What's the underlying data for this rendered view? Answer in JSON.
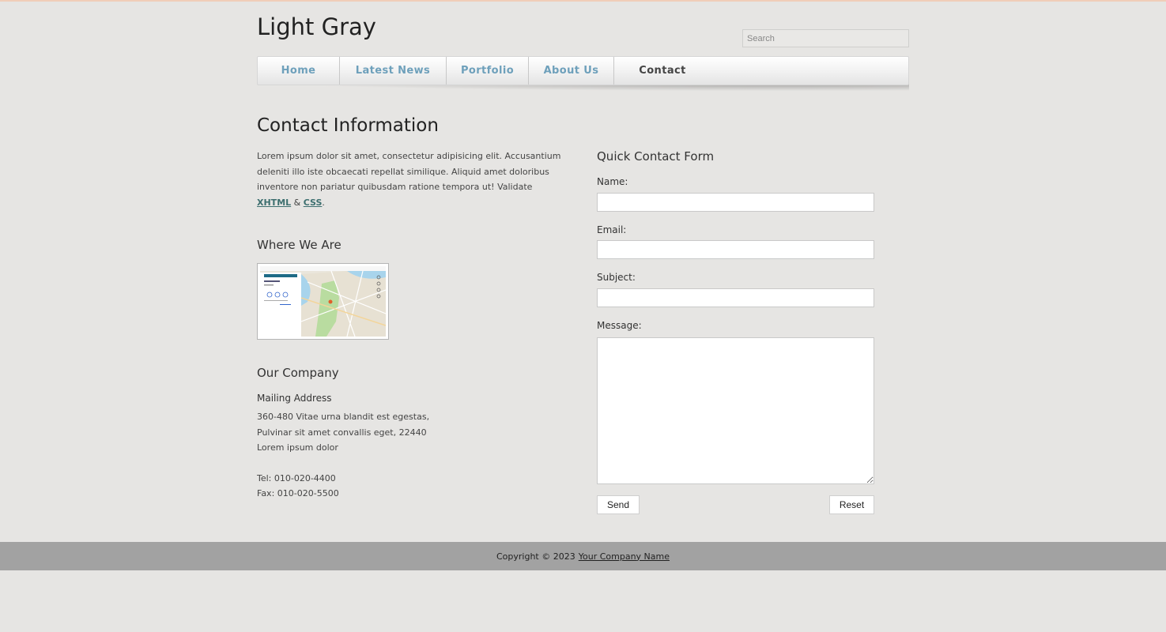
{
  "header": {
    "site_title": "Light Gray",
    "search_placeholder": "Search"
  },
  "nav": {
    "items": [
      {
        "label": "Home",
        "active": false
      },
      {
        "label": "Latest News",
        "active": false
      },
      {
        "label": "Portfolio",
        "active": false
      },
      {
        "label": "About Us",
        "active": false
      },
      {
        "label": "Contact",
        "active": true
      }
    ]
  },
  "contact_info": {
    "title": "Contact Information",
    "intro_text": "Lorem ipsum dolor sit amet, consectetur adipisicing elit. Accusantium deleniti illo iste obcaecati repellat similique. Aliquid amet doloribus inventore non pariatur quibusdam ratione tempora ut! Validate",
    "xhtml_link": "XHTML",
    "amp": "&",
    "css_link": "CSS",
    "period": "."
  },
  "where_we_are": {
    "title": "Where We Are"
  },
  "company": {
    "title": "Our Company",
    "mailing_heading": "Mailing Address",
    "address_line1": "360-480 Vitae urna blandit est egestas,",
    "address_line2": "Pulvinar sit amet convallis eget, 22440",
    "address_line3": "Lorem ipsum dolor",
    "tel": "Tel: 010-020-4400",
    "fax": "Fax: 010-020-5500"
  },
  "form": {
    "title": "Quick Contact Form",
    "name_label": "Name:",
    "email_label": "Email:",
    "subject_label": "Subject:",
    "message_label": "Message:",
    "name_value": "",
    "email_value": "",
    "subject_value": "",
    "message_value": "",
    "send_label": "Send",
    "reset_label": "Reset"
  },
  "footer": {
    "copyright": "Copyright © 2023",
    "company_link": "Your Company Name"
  },
  "colors": {
    "background": "#e6e5e3",
    "nav_link": "#6ea0bb",
    "nav_active": "#444444",
    "footer_bg": "#a2a2a2",
    "link": "#3d6f6f"
  }
}
